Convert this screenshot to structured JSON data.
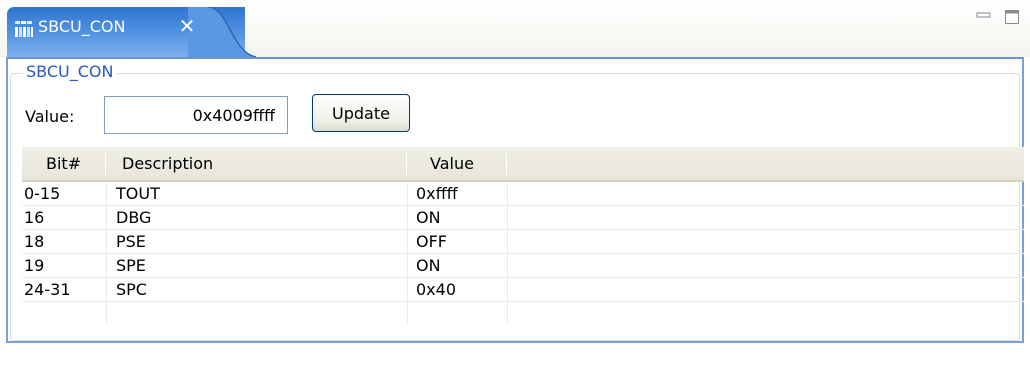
{
  "tab": {
    "title": "SBCU_CON",
    "close_symbol": "✕",
    "icon": "register-grid-icon"
  },
  "window_controls": {
    "minimize_icon": "minimize-icon",
    "maximize_icon": "maximize-icon"
  },
  "group": {
    "title": "SBCU_CON"
  },
  "value_field": {
    "label": "Value:",
    "value": "0x4009ffff"
  },
  "update_button": {
    "label": "Update"
  },
  "table": {
    "headers": [
      "Bit#",
      "Description",
      "Value"
    ],
    "rows": [
      {
        "bit": "0-15",
        "description": "TOUT",
        "value": "0xffff"
      },
      {
        "bit": "16",
        "description": "DBG",
        "value": "ON"
      },
      {
        "bit": "18",
        "description": "PSE",
        "value": "OFF"
      },
      {
        "bit": "19",
        "description": "SPE",
        "value": "ON"
      },
      {
        "bit": "24-31",
        "description": "SPC",
        "value": "0x40"
      }
    ]
  },
  "colors": {
    "tab_active": "#4d8ee0",
    "group_title": "#2a57c5",
    "frame_border": "#7aa0d8"
  }
}
